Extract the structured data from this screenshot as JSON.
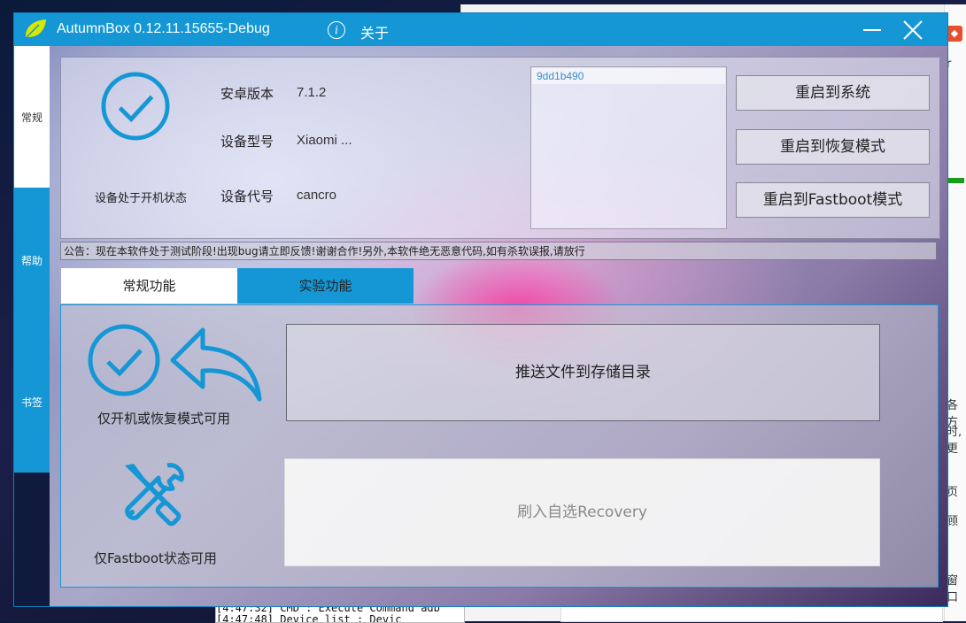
{
  "app": {
    "title": "AutumnBox  0.12.11.15655-Debug",
    "about_label": "关于",
    "info_icon": "i",
    "accent_color": "#1597d5",
    "icons": [
      "leaf-logo-icon",
      "info-icon",
      "minimize-icon",
      "close-icon",
      "check-circle-icon",
      "undo-arrow-icon",
      "tools-icon"
    ]
  },
  "sidebar": {
    "items": [
      {
        "label": "常规"
      },
      {
        "label": "帮助"
      },
      {
        "label": "书签"
      }
    ]
  },
  "device": {
    "status_text": "设备处于开机状态",
    "android_version_label": "安卓版本",
    "android_version": "7.1.2",
    "model_label": "设备型号",
    "model": "Xiaomi ...",
    "code_label": "设备代号",
    "code": "cancro"
  },
  "device_list": [
    "9dd1b490"
  ],
  "reboot_buttons": {
    "system": "重启到系统",
    "recovery": "重启到恢复模式",
    "fastboot": "重启到Fastboot模式"
  },
  "notice": "公告：现在本软件处于测试阶段!出现bug请立即反馈!谢谢合作!另外,本软件绝无恶意代码,如有杀软误报,请放行",
  "tabs": [
    {
      "label": "常规功能",
      "selected": true
    },
    {
      "label": "实验功能",
      "selected": false
    }
  ],
  "features": {
    "boot_recovery_label": "仅开机或恢复模式可用",
    "fastboot_label": "仅Fastboot状态可用",
    "push_button": "推送文件到存储目录",
    "flash_button": "刷入自选Recovery"
  },
  "background": {
    "right_fragments": [
      "r",
      "各方",
      "时,更",
      "页",
      "顾",
      "窗口"
    ],
    "console_lines": [
      "[4:47:32] CMD : Execute Command adb",
      "[4:47:48] Device list : Devic"
    ]
  }
}
